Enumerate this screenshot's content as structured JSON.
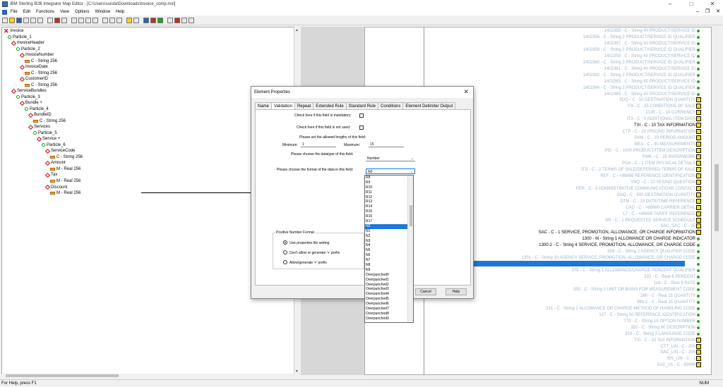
{
  "window": {
    "title": "IBM Sterling B2B Integrator Map Editor - [C:\\Users\\sunda\\Downloads\\invoice_comp.mxl]",
    "minimize": "–",
    "maximize": "□",
    "close": "✕"
  },
  "menu": {
    "items": [
      "File",
      "Edit",
      "Functions",
      "View",
      "Options",
      "Window",
      "Help"
    ],
    "mdi_minimize": "–",
    "mdi_restore": "❐",
    "mdi_close": "✕"
  },
  "left_tree": [
    {
      "label": "Invoice",
      "icon": "x-icon"
    },
    {
      "label": "Particle_1",
      "icon": "group-icon"
    },
    {
      "label": "InvoiceHeader",
      "icon": "record-icon"
    },
    {
      "label": "Particle_2",
      "icon": "group-icon"
    },
    {
      "label": "InvoiceNumber",
      "icon": "record-icon"
    },
    {
      "label": "C - String 256",
      "icon": "field-icon"
    },
    {
      "label": "InvoiceDate",
      "icon": "record-icon"
    },
    {
      "label": "C - String 256",
      "icon": "field-icon"
    },
    {
      "label": "CustomerID",
      "icon": "record-icon"
    },
    {
      "label": "C - String 256",
      "icon": "field-icon"
    },
    {
      "label": "ServiceBundles",
      "icon": "record-icon"
    },
    {
      "label": "Particle_3",
      "icon": "group-icon"
    },
    {
      "label": "Bundle +",
      "icon": "record-icon"
    },
    {
      "label": "Particle_4",
      "icon": "group-icon"
    },
    {
      "label": "BundleID",
      "icon": "record-icon"
    },
    {
      "label": "C - String 256",
      "icon": "field-icon"
    },
    {
      "label": "Services",
      "icon": "record-icon"
    },
    {
      "label": "Particle_5",
      "icon": "group-icon"
    },
    {
      "label": "Service +",
      "icon": "record-icon"
    },
    {
      "label": "Particle_6",
      "icon": "group-icon"
    },
    {
      "label": "ServiceCode",
      "icon": "record-icon"
    },
    {
      "label": "C - String 256",
      "icon": "field-icon"
    },
    {
      "label": "Amount",
      "icon": "record-icon"
    },
    {
      "label": "M - Real 256",
      "icon": "field-icon"
    },
    {
      "label": "Tax",
      "icon": "record-icon"
    },
    {
      "label": "M - Real 256",
      "icon": "field-icon"
    },
    {
      "label": "Discount",
      "icon": "record-icon"
    },
    {
      "label": "M - Real 256",
      "icon": "field-icon"
    }
  ],
  "right_tree": [
    {
      "label": "1402355 - C - String 40 PRODUCT/SERVICE ID",
      "style": "faded",
      "marker": "dot"
    },
    {
      "label": "1402356 - C - String 2 PRODUCT/SERVICE ID QUALIFIER",
      "style": "faded",
      "marker": "dot"
    },
    {
      "label": "1402357 - C - String 40 PRODUCT/SERVICE ID",
      "style": "faded",
      "marker": "dot"
    },
    {
      "label": "1402358 - C - String 2 PRODUCT/SERVICE ID QUALIFIER",
      "style": "faded",
      "marker": "dot"
    },
    {
      "label": "1402359 - C - String 40 PRODUCT/SERVICE ID",
      "style": "faded",
      "marker": "dot"
    },
    {
      "label": "1402360 - C - String 2 PRODUCT/SERVICE ID QUALIFIER",
      "style": "faded",
      "marker": "dot"
    },
    {
      "label": "1402361 - C - String 40 PRODUCT/SERVICE ID",
      "style": "faded",
      "marker": "dot"
    },
    {
      "label": "1402362 - C - String 2 PRODUCT/SERVICE ID QUALIFIER",
      "style": "faded",
      "marker": "dot"
    },
    {
      "label": "1402363 - C - String 40 PRODUCT/SERVICE ID",
      "style": "faded",
      "marker": "dot"
    },
    {
      "label": "1402364 - C - String 2 PRODUCT/SERVICE ID QUALIFIER",
      "style": "faded",
      "marker": "dot"
    },
    {
      "label": "1402365 - C - String 40 PRODUCT/SERVICE ID",
      "style": "faded",
      "marker": "dot"
    },
    {
      "label": "SDQ - C - 10 DESTINATION QUANTITY",
      "style": "faded",
      "marker": "box"
    },
    {
      "label": "IT8 - C - 25 CONDITIONS OF SALE",
      "style": "faded",
      "marker": "box"
    },
    {
      "label": "CUR - C - 10 CURRENCY",
      "style": "faded",
      "marker": "box"
    },
    {
      "label": "IT3 - C - 5 ADDITIONAL ITEM DATA",
      "style": "faded",
      "marker": "box"
    },
    {
      "label": "TXI - C - 10 TAX INFORMATION",
      "style": "dark",
      "marker": "box"
    },
    {
      "label": "CTP - C - 25 PRICING INFORMATION",
      "style": "faded",
      "marker": "box"
    },
    {
      "label": "PAM - C - 10 PERIOD AMOUNT",
      "style": "faded",
      "marker": "box"
    },
    {
      "label": "MEA - C - 40 MEASUREMENTS",
      "style": "faded",
      "marker": "box"
    },
    {
      "label": "PID - C - 1000 PRODUCT/ITEM DESCRIPTION",
      "style": "faded",
      "marker": "box"
    },
    {
      "label": "PWK - C - 25 PAPERWORK",
      "style": "faded",
      "marker": "box"
    },
    {
      "label": "PO4 - C - 1 ITEM PHYSICAL DETAILS",
      "style": "faded",
      "marker": "box"
    },
    {
      "label": "ITD - C - 2 TERMS OF SALE/DEFERRED TERMS OF SALE",
      "style": "faded",
      "marker": "box"
    },
    {
      "label": "REF - C - >99999 REFERENCE IDENTIFICATION",
      "style": "faded",
      "marker": "box"
    },
    {
      "label": "YNQ - C - 10 YES/NO QUESTION",
      "style": "faded",
      "marker": "box"
    },
    {
      "label": "PER - C - 5 ADMINISTRATIVE COMMUNICATIONS CONTACT",
      "style": "faded",
      "marker": "box"
    },
    {
      "label": "SDQ - C - 500 DESTINATION QUANTITY",
      "style": "faded",
      "marker": "box"
    },
    {
      "label": "DTM - C - 10 DATE/TIME REFERENCE",
      "style": "faded",
      "marker": "box"
    },
    {
      "label": "CAD - C - >99999 CARRIER DETAIL",
      "style": "faded",
      "marker": "box"
    },
    {
      "label": "L7 - C - >99999 TARIFF REFERENCE",
      "style": "faded",
      "marker": "box"
    },
    {
      "label": "SR - C - 1 REQUESTED SERVICE SCHEDULE",
      "style": "faded",
      "marker": "box"
    },
    {
      "label": "SAC_SAC - C - 25",
      "style": "faded",
      "marker": "box"
    },
    {
      "label": "SAC - C - 1 SERVICE, PROMOTION, ALLOWANCE, OR CHARGE INFORMATION",
      "style": "dark",
      "marker": "box"
    },
    {
      "label": "1300 - M - String 1 ALLOWANCE OR CHARGE INDICATOR",
      "style": "dark",
      "marker": "dot"
    },
    {
      "label": "1300-2 - C - String 4 SERVICE, PROMOTION, ALLOWANCE, OR CHARGE CODE",
      "style": "dark",
      "marker": "dot"
    },
    {
      "label": "559 - C - String 2 AGENCY QUALIFIER CODE",
      "style": "faded",
      "marker": "dot"
    },
    {
      "label": "1301 - C - String 10 AGENCY SERVICE, PROMOTION, ALLOWANCE, OR CHARGE CODE",
      "style": "faded",
      "marker": "dot"
    },
    {
      "label": "610 - C - Integer 15 AMOUNT",
      "style": "selected",
      "marker": "dot"
    },
    {
      "label": "378 - C - String 1 ALLOWANCE/CHARGE PERCENT QUALIFIER",
      "style": "faded",
      "marker": "dot"
    },
    {
      "label": "332 - C - Real 6 PERCENT",
      "style": "faded",
      "marker": "dot"
    },
    {
      "label": "118 - C - Real 9 RATE",
      "style": "faded",
      "marker": "dot"
    },
    {
      "label": "355 - C - String 2 UNIT OR BASIS FOR MEASUREMENT CODE",
      "style": "faded",
      "marker": "dot"
    },
    {
      "label": "380 - C - Real 15 QUANTITY",
      "style": "faded",
      "marker": "dot"
    },
    {
      "label": "380-2 - C - Real 15 QUANTITY",
      "style": "faded",
      "marker": "dot"
    },
    {
      "label": "331 - C - String 2 ALLOWANCE OR CHARGE METHOD OF HANDLING CODE",
      "style": "faded",
      "marker": "dot"
    },
    {
      "label": "127 - C - String 50 REFERENCE IDENTIFICATION",
      "style": "faded",
      "marker": "dot"
    },
    {
      "label": "770 - C - String 15 OPTION NUMBER",
      "style": "faded",
      "marker": "dot"
    },
    {
      "label": "352 - C - String 80 DESCRIPTION",
      "style": "faded",
      "marker": "dot"
    },
    {
      "label": "819 - C - String 3 LANGUAGE CODE",
      "style": "faded",
      "marker": "dot"
    },
    {
      "label": "TXI - C - 10 TAX INFORMATION",
      "style": "faded",
      "marker": "box"
    },
    {
      "label": "CTT_LIN - C - 200",
      "style": "faded",
      "marker": "box"
    },
    {
      "label": "SAC_LIN - C - 200",
      "style": "faded",
      "marker": "box"
    },
    {
      "label": "ISS_LIN - C - 1",
      "style": "faded",
      "marker": "box"
    },
    {
      "label": "SAC_V1 - C - 99999",
      "style": "faded",
      "marker": "box"
    }
  ],
  "dialog": {
    "title": "Element Properties",
    "close": "✕",
    "tabs": [
      "Name",
      "Validation",
      "Repeat",
      "Extended Rule",
      "Standard Rule",
      "Conditions",
      "Element Delimiter Output"
    ],
    "active_tab": "Validation",
    "mandatory_label": "Check here if this field is mandatory:",
    "not_used_label": "Check here if this field is not used:",
    "lengths_label": "Please set the allowed lengths of this field:",
    "minimum_label": "Minimum:",
    "minimum_value": "1",
    "maximum_label": "Maximum:",
    "maximum_value": "15",
    "datatype_label": "Please choose the datatype of this field:",
    "datatype_value": "Number",
    "format_label": "Please choose the format of the data in this field:",
    "format_value": "N0",
    "format_options": [
      "R8",
      "R9",
      "R10",
      "R11",
      "R12",
      "R13",
      "R14",
      "R15",
      "R16",
      "R17",
      "N0",
      "N1",
      "N2",
      "N3",
      "N4",
      "N5",
      "N6",
      "N7",
      "N8",
      "N9",
      "Overpunched0",
      "Overpunched1",
      "Overpunched2",
      "Overpunched3",
      "Overpunched4",
      "Overpunched5",
      "Overpunched6",
      "Overpunched7",
      "Overpunched8",
      "Overpunched9"
    ],
    "positive_group_label": "Positive Number Format",
    "radio_use_props": "Use properties file setting",
    "radio_dont_allow": "Don't allow or generate '+' prefix",
    "radio_allow": "Allow/generate '+' prefix",
    "cancel_button": "Cancel",
    "help_button": "Help"
  },
  "status": {
    "text": "For Help, press F1",
    "num": "NUM"
  }
}
